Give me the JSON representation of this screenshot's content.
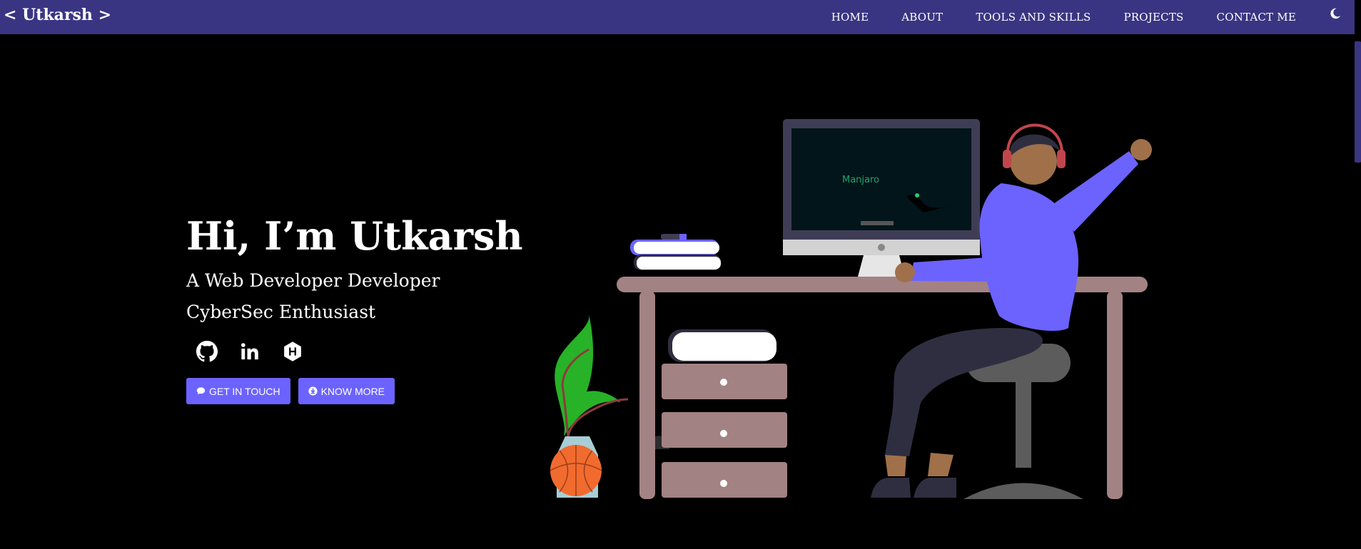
{
  "nav": {
    "brand": "< Utkarsh >",
    "links": [
      "HOME",
      "ABOUT",
      "TOOLS AND SKILLS",
      "PROJECTS",
      "CONTACT ME"
    ],
    "theme_icon": "moon-icon"
  },
  "hero": {
    "title": "Hi, I’m Utkarsh",
    "subtitle_1": "A Web Developer Developer",
    "subtitle_2": "CyberSec Enthusiast",
    "socials": [
      "github-icon",
      "linkedin-icon",
      "hackerrank-icon"
    ],
    "buttons": {
      "get_in_touch": "GET IN TOUCH",
      "know_more": "KNOW MORE"
    }
  },
  "illustration": {
    "screen_text": "Manjaro"
  },
  "colors": {
    "navbar": "#3a3582",
    "accent": "#6c63ff",
    "background": "#000000",
    "desk": "#a38283"
  }
}
